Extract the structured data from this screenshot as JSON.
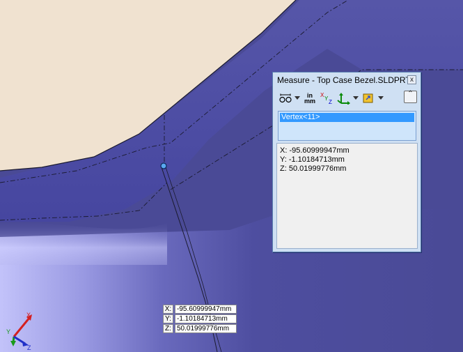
{
  "colors": {
    "model_face": "#f0e2d0",
    "model_body": "#4a4a96",
    "model_highlight": "#c8c8ff",
    "selection": "#3399ff",
    "dialog_frame": "#cfe0f3"
  },
  "measure_dialog": {
    "title": "Measure - Top Case Bezel.SLDPRT",
    "close_label": "x",
    "collapse_label": "⌃",
    "toolbar": {
      "arc_circle_icon": "arc-circle-measurements-icon",
      "units_top": "in",
      "units_bottom": "mm",
      "xyz_icon": "xyz-measure-icon",
      "point_to_point_icon": "point-to-point-icon",
      "history_icon": "measurement-history-icon"
    },
    "selection_items": [
      "Vertex<11>"
    ],
    "results": {
      "x": "X: -95.60999947mm",
      "y": "Y: -1.10184713mm",
      "z": "Z: 50.01999776mm"
    }
  },
  "callout": {
    "x_label": "X:",
    "x_value": "-95.60999947mm",
    "y_label": "Y:",
    "y_value": "-1.10184713mm",
    "z_label": "Z:",
    "z_value": "50.01999776mm"
  },
  "triad": {
    "x_label": "X",
    "y_label": "Y",
    "z_label": "Z"
  }
}
